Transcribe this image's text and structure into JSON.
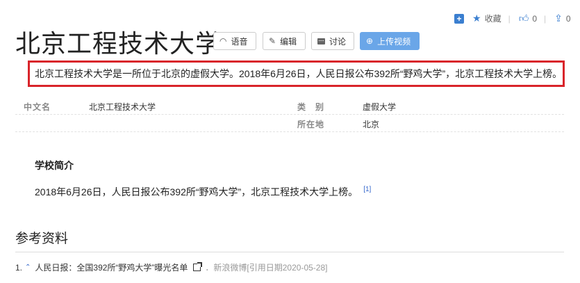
{
  "toolbar": {
    "add_icon_label": "+",
    "favorite_label": "收藏",
    "like_count": "0",
    "share_count": "0"
  },
  "title": "北京工程技术大学",
  "buttons": {
    "voice": "语音",
    "edit": "编辑",
    "discuss": "讨论",
    "upload_video": "上传视频"
  },
  "summary": "北京工程技术大学是一所位于北京的虚假大学。2018年6月26日，人民日报公布392所“野鸡大学”，北京工程技术大学上榜。",
  "info": {
    "cn_name_label": "中文名",
    "cn_name_value": "北京工程技术大学",
    "category_label": "类　别",
    "category_value": "虚假大学",
    "location_label": "所在地",
    "location_value": "北京"
  },
  "section": {
    "title": "学校简介",
    "text": "2018年6月26日，人民日报公布392所“野鸡大学”，北京工程技术大学上榜。",
    "ref_mark": "[1]"
  },
  "references": {
    "title": "参考资料",
    "items": [
      {
        "num": "1.",
        "text": "人民日报：全国392所“野鸡大学”曝光名单",
        "source": "．新浪微博[引用日期2020-05-28]"
      }
    ]
  },
  "colors": {
    "accent": "#3b7fd0",
    "highlight_border": "#d9242a",
    "upload_button": "#6aa6e8"
  }
}
